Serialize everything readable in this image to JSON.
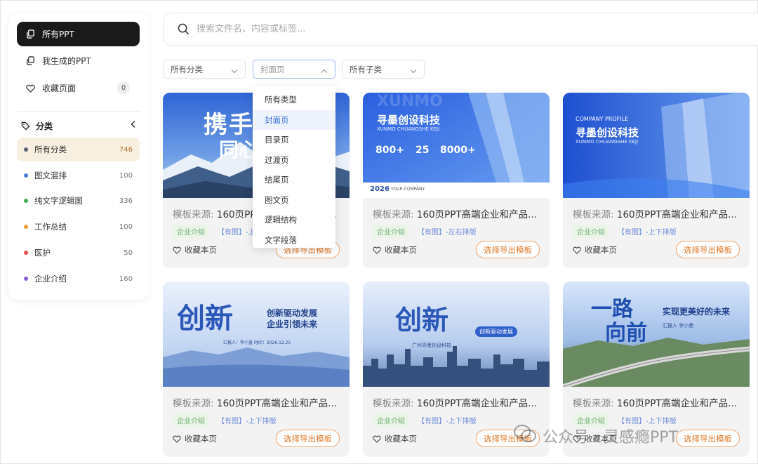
{
  "search": {
    "placeholder": "搜索文件名、内容或标签..."
  },
  "nav": [
    {
      "label": "所有PPT",
      "icon": "copy-icon",
      "active": true
    },
    {
      "label": "我生成的PPT",
      "icon": "copy-icon",
      "active": false
    },
    {
      "label": "收藏页面",
      "icon": "heart-icon",
      "badge": "0"
    }
  ],
  "categories": {
    "heading": "分类",
    "items": [
      {
        "label": "所有分类",
        "count": "746",
        "color": "#5a5f75",
        "active": true
      },
      {
        "label": "图文混排",
        "count": "100",
        "color": "#4a7de0"
      },
      {
        "label": "纯文字逻辑图",
        "count": "336",
        "color": "#3fae5a"
      },
      {
        "label": "工作总结",
        "count": "100",
        "color": "#e8a23a"
      },
      {
        "label": "医护",
        "count": "50",
        "color": "#e2514d"
      },
      {
        "label": "企业介绍",
        "count": "160",
        "color": "#8b5bd6"
      }
    ]
  },
  "filters": {
    "category": "所有分类",
    "page_type": "封面页",
    "subcategory": "所有子类"
  },
  "dropdown": {
    "options": [
      "所有类型",
      "封面页",
      "目录页",
      "过渡页",
      "结尾页",
      "图文页",
      "逻辑结构",
      "文字段落"
    ],
    "selected": "封面页"
  },
  "cards": [
    {
      "source_label": "模板来源:",
      "title": "160页PPT高端企业和产品...",
      "tag": "企业介绍",
      "layout": "【有图】-上下排版",
      "fav": "收藏本页",
      "export": "选择导出模板",
      "thumb": {
        "big": "携手共",
        "big2": "同心",
        "small": ""
      }
    },
    {
      "source_label": "模板来源:",
      "title": "160页PPT高端企业和产品...",
      "tag": "企业介绍",
      "layout": "【有图】-左右排版",
      "fav": "收藏本页",
      "export": "选择导出模板",
      "thumb": {
        "ghost": "XUNMO",
        "title": "寻墨创设科技",
        "sub": "XUNMO CHUANGSHE KEJI",
        "stats": [
          "800+",
          "25",
          "8000+"
        ],
        "year": "2026",
        "company": "YOUR COMPANY"
      }
    },
    {
      "source_label": "模板来源:",
      "title": "160页PPT高端企业和产品...",
      "tag": "企业介绍",
      "layout": "【有图】-上下排版",
      "fav": "收藏本页",
      "export": "选择导出模板",
      "thumb": {
        "eyebrow": "COMPANY PROFILE",
        "title": "寻墨创设科技",
        "sub": "XUNMO CHUANGSHE KEJI"
      }
    },
    {
      "source_label": "模板来源:",
      "title": "160页PPT高端企业和产品...",
      "tag": "企业介绍",
      "layout": "【有图】-上下排版",
      "fav": "收藏本页",
      "export": "选择导出模板",
      "thumb": {
        "big": "创新",
        "line1": "创新驱动发展",
        "line2": "企业引领未来",
        "meta": "汇报人：李小墨    时间：2026.12.25"
      }
    },
    {
      "source_label": "模板来源:",
      "title": "160页PPT高端企业和产品...",
      "tag": "企业介绍",
      "layout": "【有图】-上下排版",
      "fav": "收藏本页",
      "export": "选择导出模板",
      "thumb": {
        "big": "创新",
        "pill": "创新驱动发展",
        "sub": "广州寻墨创设科技"
      }
    },
    {
      "source_label": "模板来源:",
      "title": "160页PPT高端企业和产品...",
      "tag": "企业介绍",
      "layout": "【有图】-上下排版",
      "fav": "收藏本页",
      "export": "选择导出模板",
      "thumb": {
        "big1": "一路",
        "big2": "向前",
        "line": "实现更美好的未来",
        "meta": "汇报人  李小墨"
      }
    }
  ],
  "watermark": "公众号 · 灵感瘾PPT"
}
